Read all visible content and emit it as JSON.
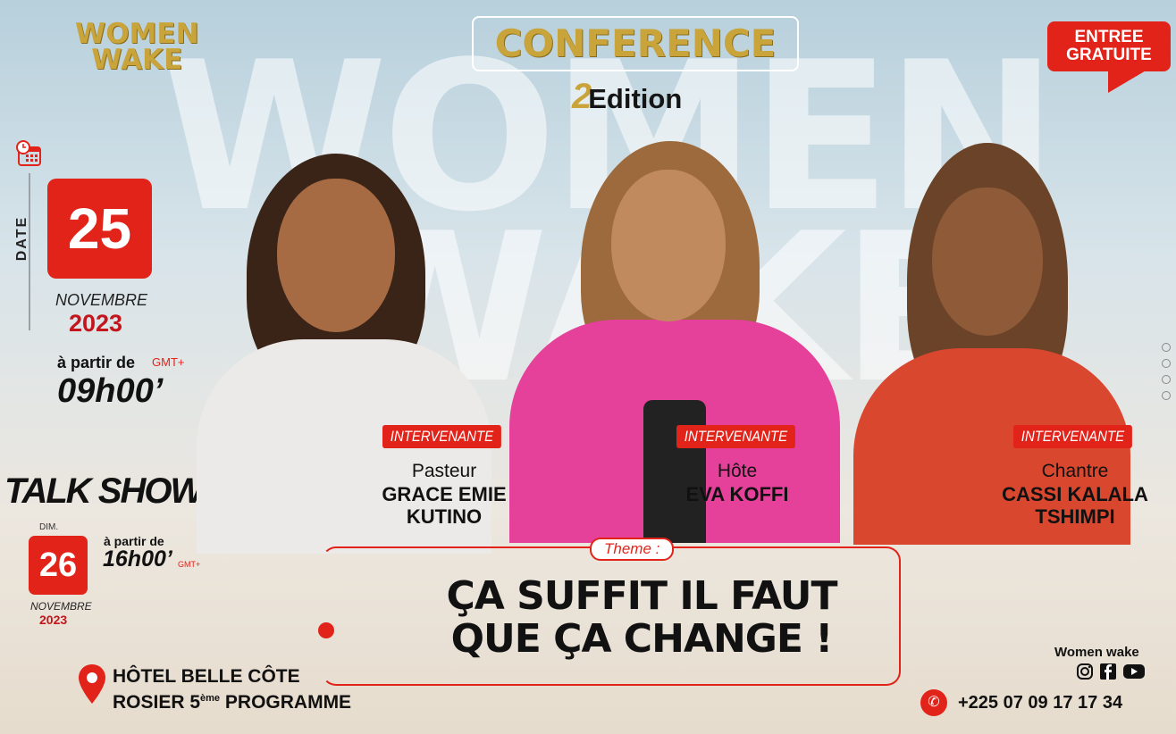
{
  "background": {
    "word1": "WOMEN",
    "word2": "WAKE"
  },
  "logo": {
    "line1": "WOMEN",
    "line2": "WAKE"
  },
  "conference": {
    "title": "CONFERENCE",
    "edition_number": "2",
    "edition_label": "Edition"
  },
  "entree": {
    "line1": "ENTREE",
    "line2": "GRATUITE"
  },
  "date_section": {
    "label": "DATE",
    "day": "25",
    "month": "NOVEMBRE",
    "year": "2023",
    "from_label": "à partir de",
    "gmt": "GMT+",
    "time": "09h00’"
  },
  "talk_show": {
    "title": "TALK SHOW",
    "weekday": "DIM.",
    "day": "26",
    "month": "NOVEMBRE",
    "year": "2023",
    "from_label": "à partir de",
    "time": "16h00’",
    "gmt": "GMT+"
  },
  "speakers": [
    {
      "badge": "INTERVENANTE",
      "role": "Pasteur",
      "name_line1": "GRACE EMIE",
      "name_line2": "KUTINO"
    },
    {
      "badge": "INTERVENANTE",
      "role": "Hôte",
      "name_line1": "EVA KOFFI",
      "name_line2": ""
    },
    {
      "badge": "INTERVENANTE",
      "role": "Chantre",
      "name_line1": "CASSI KALALA",
      "name_line2": "TSHIMPI"
    }
  ],
  "theme": {
    "tag": "Theme :",
    "line1": "ÇA SUFFIT IL FAUT",
    "line2": "QUE ÇA CHANGE !"
  },
  "venue": {
    "line1": "HÔTEL BELLE CÔTE",
    "line2_pre": "ROSIER 5",
    "line2_sup": "ème",
    "line2_post": " PROGRAMME"
  },
  "contact": {
    "brand": "Women wake",
    "phone": "+225 07 09 17 17 34"
  },
  "colors": {
    "accent": "#e2231a",
    "gold": "#c9a43a",
    "pink": "#e5409a"
  }
}
